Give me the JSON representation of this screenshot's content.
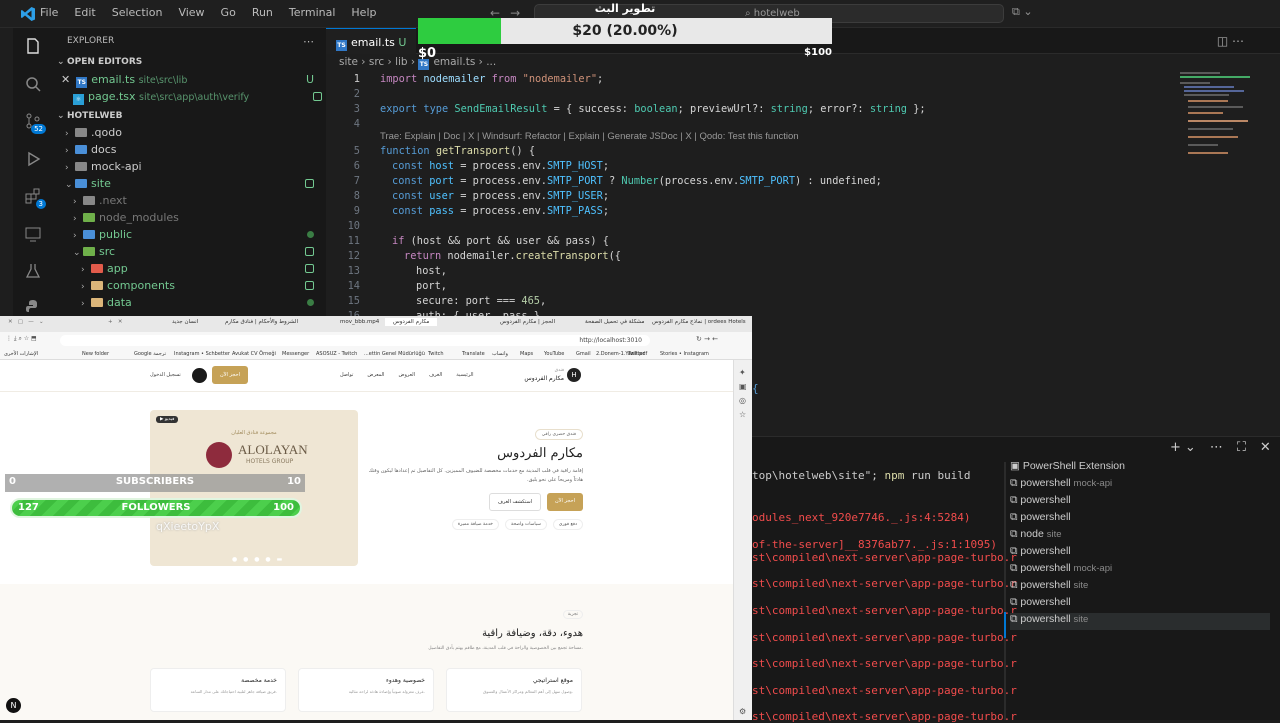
{
  "titlebar": {
    "menu": [
      "File",
      "Edit",
      "Selection",
      "View",
      "Go",
      "Run",
      "Terminal",
      "Help"
    ],
    "search": "hotelweb"
  },
  "activity": {
    "scm_badge": "52",
    "ext_badge": "3"
  },
  "sidebar": {
    "title": "EXPLORER",
    "open_editors_label": "OPEN EDITORS",
    "open_editors": [
      {
        "name": "email.ts",
        "path": "site\\src\\lib",
        "status": "U"
      },
      {
        "name": "page.tsx",
        "path": "site\\src\\app\\auth\\verify",
        "status": ""
      }
    ],
    "project_label": "HOTELWEB",
    "tree": [
      ".qodo",
      "docs",
      "mock-api",
      "site",
      ".next",
      "node_modules",
      "public",
      "src",
      "app",
      "components",
      "data"
    ]
  },
  "editor": {
    "tab": {
      "name": "email.ts",
      "status": "U"
    },
    "breadcrumb": [
      "site",
      "src",
      "lib",
      "email.ts",
      "..."
    ],
    "line_numbers": [
      "1",
      "2",
      "3",
      "4",
      "5",
      "6",
      "7",
      "8",
      "9",
      "10",
      "11",
      "12",
      "13",
      "14",
      "15",
      "16"
    ],
    "codelens": "Trae: Explain | Doc | X | Windsurf: Refactor | Explain | Generate JSDoc | X | Qodo: Test this function",
    "code": {
      "l1": [
        "import",
        " nodemailer ",
        "from",
        " ",
        "\"nodemailer\"",
        ";"
      ],
      "l3": [
        "export type",
        " ",
        "SendEmailResult",
        " = { success: ",
        "boolean",
        "; previewUrl?: ",
        "string",
        "; error?: ",
        "string",
        " };"
      ],
      "l5": [
        "function",
        " ",
        "getTransport",
        "() {"
      ],
      "l6": [
        "const",
        " ",
        "host",
        " = process.env.",
        "SMTP_HOST",
        ";"
      ],
      "l7": [
        "const",
        " ",
        "port",
        " = process.env.",
        "SMTP_PORT",
        " ? ",
        "Number",
        "(process.env.",
        "SMTP_PORT",
        ") : undefined;"
      ],
      "l8": [
        "const",
        " ",
        "user",
        " = process.env.",
        "SMTP_USER",
        ";"
      ],
      "l9": [
        "const",
        " ",
        "pass",
        " = process.env.",
        "SMTP_PASS",
        ";"
      ],
      "l11": [
        "if",
        " (host && port && user && pass) {"
      ],
      "l12": [
        "return",
        " nodemailer.",
        "createTransport",
        "({"
      ],
      "l13": "host,",
      "l14": "port,",
      "l15": [
        "secure: port === ",
        "465",
        ","
      ],
      "l16": "auth: { user, pass }"
    }
  },
  "progress": {
    "title": "تطوير البث",
    "label": "$20 (20.00%)",
    "fraction": 0.2,
    "min": "$0",
    "max": "$100"
  },
  "subs_bar": {
    "min": "0",
    "label": "SUBSCRIBERS",
    "max": "10"
  },
  "followers_bar": {
    "min": "127",
    "label": "FOLLOWERS",
    "max": "100",
    "latest": "qXieetoYpX"
  },
  "browser": {
    "tabs": [
      "نماذج مكارم الفردوس | ordees Hotels",
      "مشكلة في تحميل الصفحة",
      "الحجز | مكارم الفردوس",
      "مكارم الفردوس",
      "mov_bbb.mp4",
      "الشروط والأحكام | فنادق مكارم",
      "انسان جديد"
    ],
    "url": "http://localhost:3010",
    "bookmarks": [
      "Stories • Instagram",
      "Twitter",
      "2.Donem-1.Yazili.pdf",
      "Gmail",
      "YouTube",
      "Maps",
      "واتساب",
      "Translate",
      "Twitch",
      "...ettin Genel Müdürlüğü",
      "ASOSUZ - Twitch",
      "Messenger",
      "Avukat CV Örneği",
      "Instagram • Schbetter",
      "Google ترجمة",
      "New folder",
      "الإشارات الأخرى"
    ]
  },
  "site": {
    "brand_small": "فندق",
    "brand": "مكارم الفردوس",
    "nav": [
      "الرئيسية",
      "الغرف",
      "العروض",
      "المعرض",
      "تواصل"
    ],
    "book_button": "احجز الآن",
    "login": "تسجيل الدخول",
    "hero_tag": "فندق حضري راقي",
    "hero_title": "مكارم الفردوس",
    "hero_desc": "إقامة راقية في قلب المدينة مع خدمات مخصصة للضيوف المميزين. كل التفاصيل تم إعدادها ليكون وقتك هادئاً ومريحاً على نحو يليق.",
    "cta_primary": "احجز الآن",
    "cta_secondary": "استكشف الغرف",
    "chips": [
      "دفع فوري",
      "سياسات واضحة",
      "خدمة ضيافة مميزة"
    ],
    "video_badge": "فيديو",
    "logo_group": "مجموعة فنادق العليان",
    "logo_name": "ALOLAYAN",
    "logo_sub": "HOTELS GROUP",
    "section_tag": "تجربة",
    "section_title": "هدوء، دقة، وضيافة راقية",
    "section_desc": "مساحة تجمع بين الخصوصية والراحة في قلب المدينة، مع طاقم يهتم بأدق التفاصيل.",
    "features": [
      {
        "title": "موقع استراتيجي",
        "desc": "وصول سهل إلى أهم المعالم ومراكز الأعمال والتسوق."
      },
      {
        "title": "خصوصية وهدوء",
        "desc": "غرف معزولة صوتياً وإضاءة هادئة لراحة مثالية."
      },
      {
        "title": "خدمة مخصصة",
        "desc": "فريق ضيافة جاهز لتلبية احتياجاتك على مدار الساعة."
      }
    ]
  },
  "terminal": {
    "command": [
      "top\\hotelweb\\site\"; ",
      "npm",
      " run build"
    ],
    "errors": [
      "odules_next_920e7746._.js:4:5284)",
      "of-the-server]__8376ab77._.js:1:1095)",
      "st\\compiled\\next-server\\app-page-turbo.r",
      "st\\compiled\\next-server\\app-page-turbo.r",
      "st\\compiled\\next-server\\app-page-turbo.r",
      "st\\compiled\\next-server\\app-page-turbo.r",
      "st\\compiled\\next-server\\app-page-turbo.r",
      "st\\compiled\\next-server\\app-page-turbo.r",
      "st\\compiled\\next-server\\app-page-turbo.r"
    ],
    "sessions": [
      {
        "name": "PowerShell Extension",
        "sub": ""
      },
      {
        "name": "powershell",
        "sub": "mock-api"
      },
      {
        "name": "powershell",
        "sub": ""
      },
      {
        "name": "powershell",
        "sub": ""
      },
      {
        "name": "node",
        "sub": "site"
      },
      {
        "name": "powershell",
        "sub": ""
      },
      {
        "name": "powershell",
        "sub": "mock-api"
      },
      {
        "name": "powershell",
        "sub": "site"
      },
      {
        "name": "powershell",
        "sub": ""
      },
      {
        "name": "powershell",
        "sub": "site"
      }
    ],
    "toolbar": [
      "+",
      "⌄",
      "⋯",
      "⛶",
      "✕"
    ]
  },
  "colors": {
    "accent": "#0078d4",
    "gold": "#c6a257",
    "progress": "#2ecc40",
    "error": "#f14c4c"
  }
}
